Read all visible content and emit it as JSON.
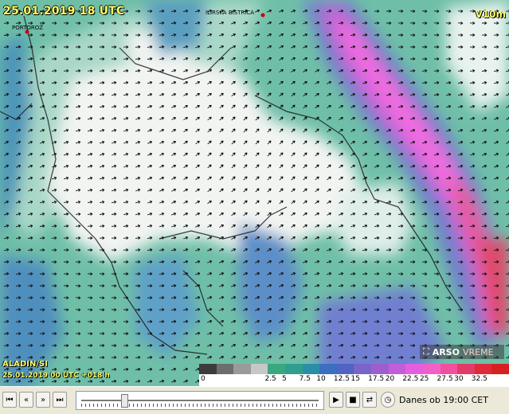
{
  "map": {
    "valid_time": "25.01.2019 18 UTC",
    "parameter": "V10m",
    "model": "ALADIN/SI",
    "run_info": "25.01.2019 00 UTC +018 h",
    "logo": {
      "brand": "ARSO",
      "suffix": "VREME"
    },
    "cities": [
      {
        "name": "PORTOROŽ"
      },
      {
        "name": "ILIRSKA BISTRICA"
      }
    ],
    "wind_speed_legend": {
      "colors": [
        "#3c3c3c",
        "#6d6d6d",
        "#9a9a9a",
        "#c7c7c7",
        "#3aa87e",
        "#2f9e8e",
        "#2a8ea6",
        "#3b6fc0",
        "#4f64c4",
        "#7b63c8",
        "#9e5fcc",
        "#c25fd8",
        "#e35fe0",
        "#f25fc6",
        "#f24f9e",
        "#e23b6a",
        "#e02a3a",
        "#d82020"
      ],
      "labels": [
        "0",
        "2.5",
        "5",
        "7.5",
        "10",
        "12.5",
        "15",
        "17.5",
        "20",
        "22.5",
        "25",
        "27.5",
        "30",
        "32.5"
      ]
    }
  },
  "controls": {
    "status": "Danes ob 19:00 CET",
    "slider_position": 0.18,
    "icons": [
      "skip-to-start-icon",
      "step-back-icon",
      "step-forward-icon",
      "skip-to-end-icon",
      "play-icon",
      "stop-icon",
      "loop-icon",
      "clock-icon"
    ]
  }
}
